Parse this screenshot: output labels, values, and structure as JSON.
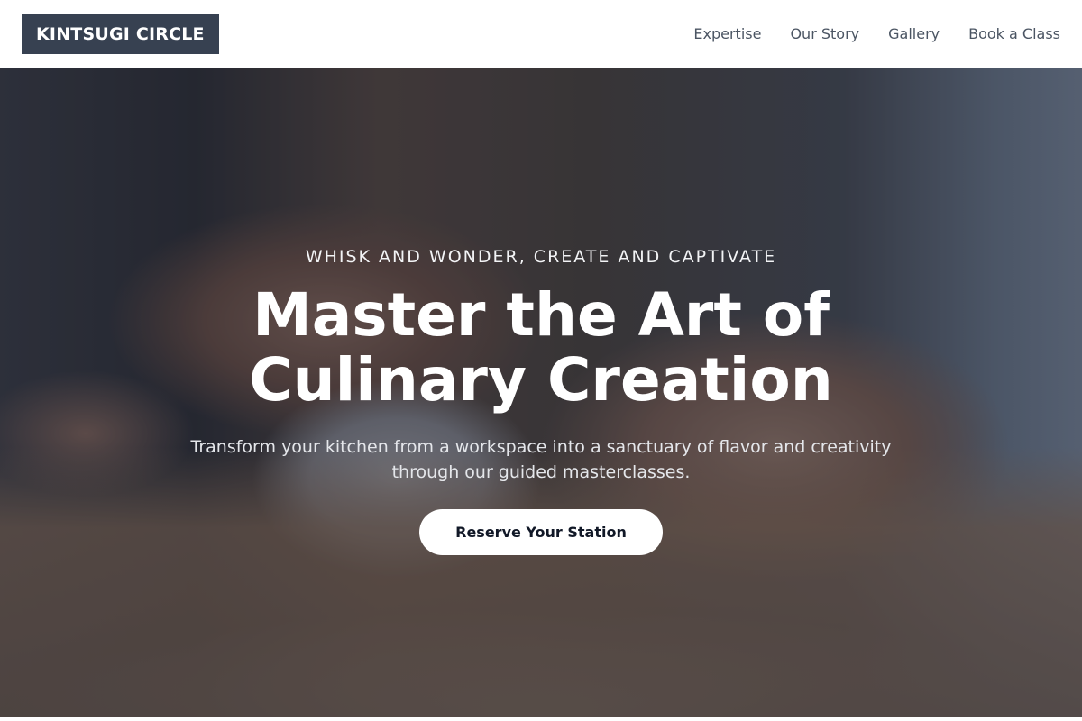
{
  "brand": {
    "name": "KINTSUGI CIRCLE"
  },
  "nav": {
    "items": [
      {
        "label": "Expertise"
      },
      {
        "label": "Our Story"
      },
      {
        "label": "Gallery"
      },
      {
        "label": "Book a Class"
      }
    ]
  },
  "hero": {
    "eyebrow": "WHISK AND WONDER, CREATE AND CAPTIVATE",
    "headline_line1": "Master the Art of",
    "headline_line2": "Culinary Creation",
    "subtitle_line1": "Transform your kitchen from a workspace into a sanctuary of flavor and creativity",
    "subtitle_line2": "through our guided masterclasses.",
    "cta_label": "Reserve Your Station",
    "background_image": "hands-shaping-dough-on-floured-table"
  },
  "colors": {
    "brand_bg": "#374151",
    "nav_text": "#4b5563",
    "cta_bg": "#ffffff",
    "cta_text": "#111827"
  }
}
